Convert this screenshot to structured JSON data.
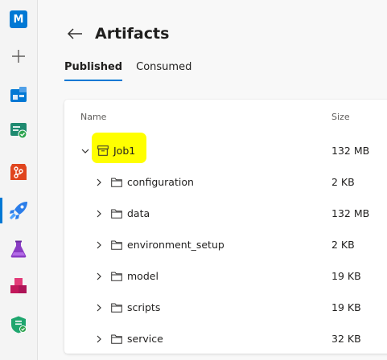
{
  "rail": {
    "org_initial": "M",
    "items": [
      {
        "icon": "plus-icon"
      },
      {
        "icon": "boards-icon"
      },
      {
        "icon": "test-plans-icon"
      },
      {
        "icon": "repos-icon"
      },
      {
        "icon": "pipelines-icon"
      },
      {
        "icon": "flask-icon"
      },
      {
        "icon": "artifacts-icon"
      },
      {
        "icon": "security-shield-icon"
      }
    ]
  },
  "header": {
    "title": "Artifacts"
  },
  "tabs": [
    {
      "label": "Published",
      "selected": true
    },
    {
      "label": "Consumed",
      "selected": false
    }
  ],
  "table": {
    "columns": {
      "name": "Name",
      "size": "Size"
    },
    "root": {
      "name": "Job1",
      "size": "132 MB",
      "expanded": true,
      "highlight_color": "#ffff00"
    },
    "children": [
      {
        "name": "configuration",
        "size": "2 KB"
      },
      {
        "name": "data",
        "size": "132 MB"
      },
      {
        "name": "environment_setup",
        "size": "2 KB"
      },
      {
        "name": "model",
        "size": "19 KB"
      },
      {
        "name": "scripts",
        "size": "19 KB"
      },
      {
        "name": "service",
        "size": "32 KB"
      }
    ]
  },
  "colors": {
    "accent": "#0078d4"
  }
}
